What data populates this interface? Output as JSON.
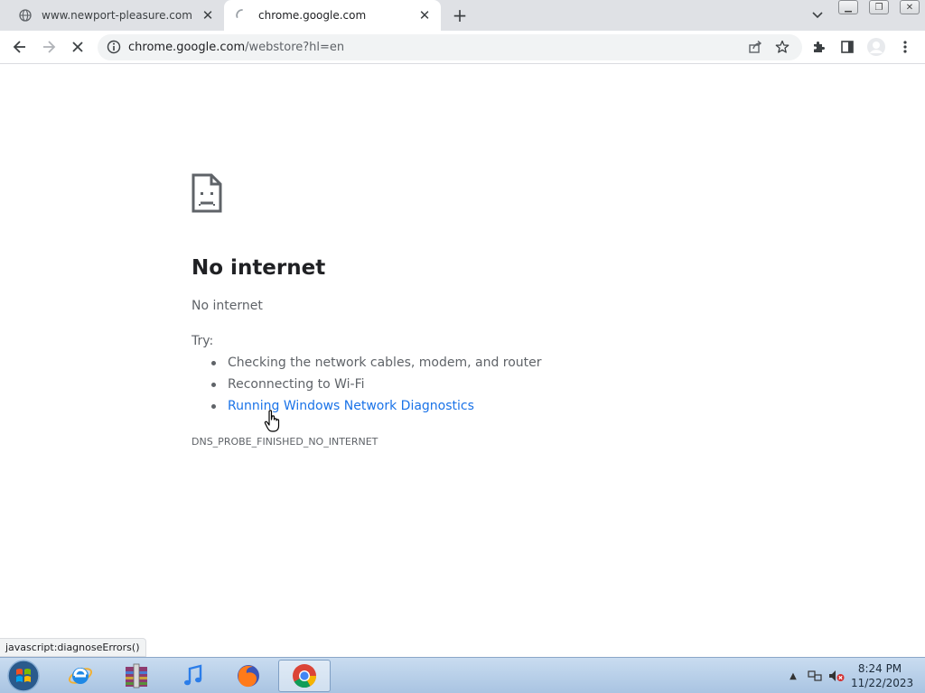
{
  "browser": {
    "tabs": [
      {
        "title": "www.newport-pleasure.com",
        "active": false
      },
      {
        "title": "chrome.google.com",
        "active": true,
        "loading": true
      }
    ],
    "address": {
      "host": "chrome.google.com",
      "path": "/webstore?hl=en"
    }
  },
  "page": {
    "heading": "No internet",
    "subheading": "No internet",
    "try_label": "Try:",
    "suggestions": [
      "Checking the network cables, modem, and router",
      "Reconnecting to Wi-Fi",
      "Running Windows Network Diagnostics"
    ],
    "error_code": "DNS_PROBE_FINISHED_NO_INTERNET"
  },
  "status_bar": {
    "text": "javascript:diagnoseErrors()"
  },
  "taskbar": {
    "apps": [
      "internet-explorer",
      "file-archive",
      "itunes",
      "firefox",
      "chrome"
    ],
    "clock": {
      "time": "8:24 PM",
      "date": "11/22/2023"
    }
  },
  "colors": {
    "link": "#1a73e8",
    "text_secondary": "#5f6368",
    "tabstrip": "#dfe1e5"
  }
}
